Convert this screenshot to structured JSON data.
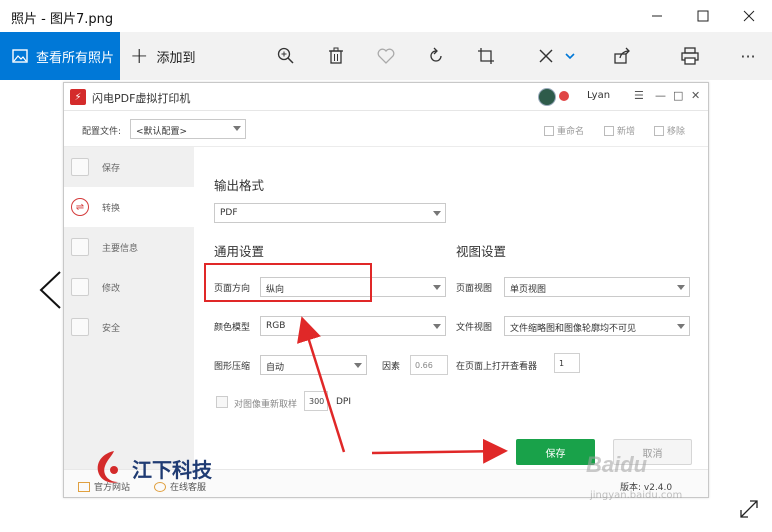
{
  "window": {
    "title": "照片 - 图片7.png",
    "controls": [
      "minimize",
      "maximize",
      "close"
    ]
  },
  "toolbar": {
    "view_all_label": "查看所有照片",
    "add_to_label": "添加到",
    "icons": [
      "zoom-in-icon",
      "delete-icon",
      "favorite-icon",
      "rotate-icon",
      "crop-icon",
      "edit-icon",
      "share-icon",
      "print-icon",
      "more-icon"
    ],
    "more_glyph": "···"
  },
  "app": {
    "name": "闪电PDF虚拟打印机",
    "user": "Lyan",
    "config_label": "配置文件:",
    "config_value": "<默认配置>",
    "rename_label": "重命名",
    "new_label": "新增",
    "remove_label": "移除",
    "sidebar": [
      {
        "label": "保存"
      },
      {
        "label": "转换"
      },
      {
        "label": "主要信息"
      },
      {
        "label": "修改"
      },
      {
        "label": "安全"
      }
    ],
    "output_format_heading": "输出格式",
    "output_format_value": "PDF",
    "general_heading": "通用设置",
    "view_heading": "视图设置",
    "orientation_label": "页面方向",
    "orientation_value": "纵向",
    "color_label": "颜色模型",
    "color_value": "RGB",
    "compress_label": "图形压缩",
    "compress_value": "自动",
    "factor_label": "因素",
    "factor_value": "0.66",
    "resample_label": "对图像重新取样",
    "resample_value": "300",
    "dpi_label": "DPI",
    "page_view_label": "页面视图",
    "page_view_value": "单页视图",
    "doc_view_label": "文件视图",
    "doc_view_value": "文件缩略图和图像轮廓均不可见",
    "open_viewer_label": "在页面上打开查看器",
    "open_viewer_value": "1",
    "save_label": "保存",
    "cancel_label": "取消",
    "website_label": "官方网站",
    "service_label": "在线客服",
    "version": "版本: v2.4.0"
  },
  "watermark": {
    "brand": "江下科技",
    "baidu": "Baidu",
    "baidu_sub": "jingyan.baidu.com"
  },
  "colors": {
    "accent": "#0078d7",
    "save_green": "#19a24a",
    "annotation_red": "#e02828"
  }
}
